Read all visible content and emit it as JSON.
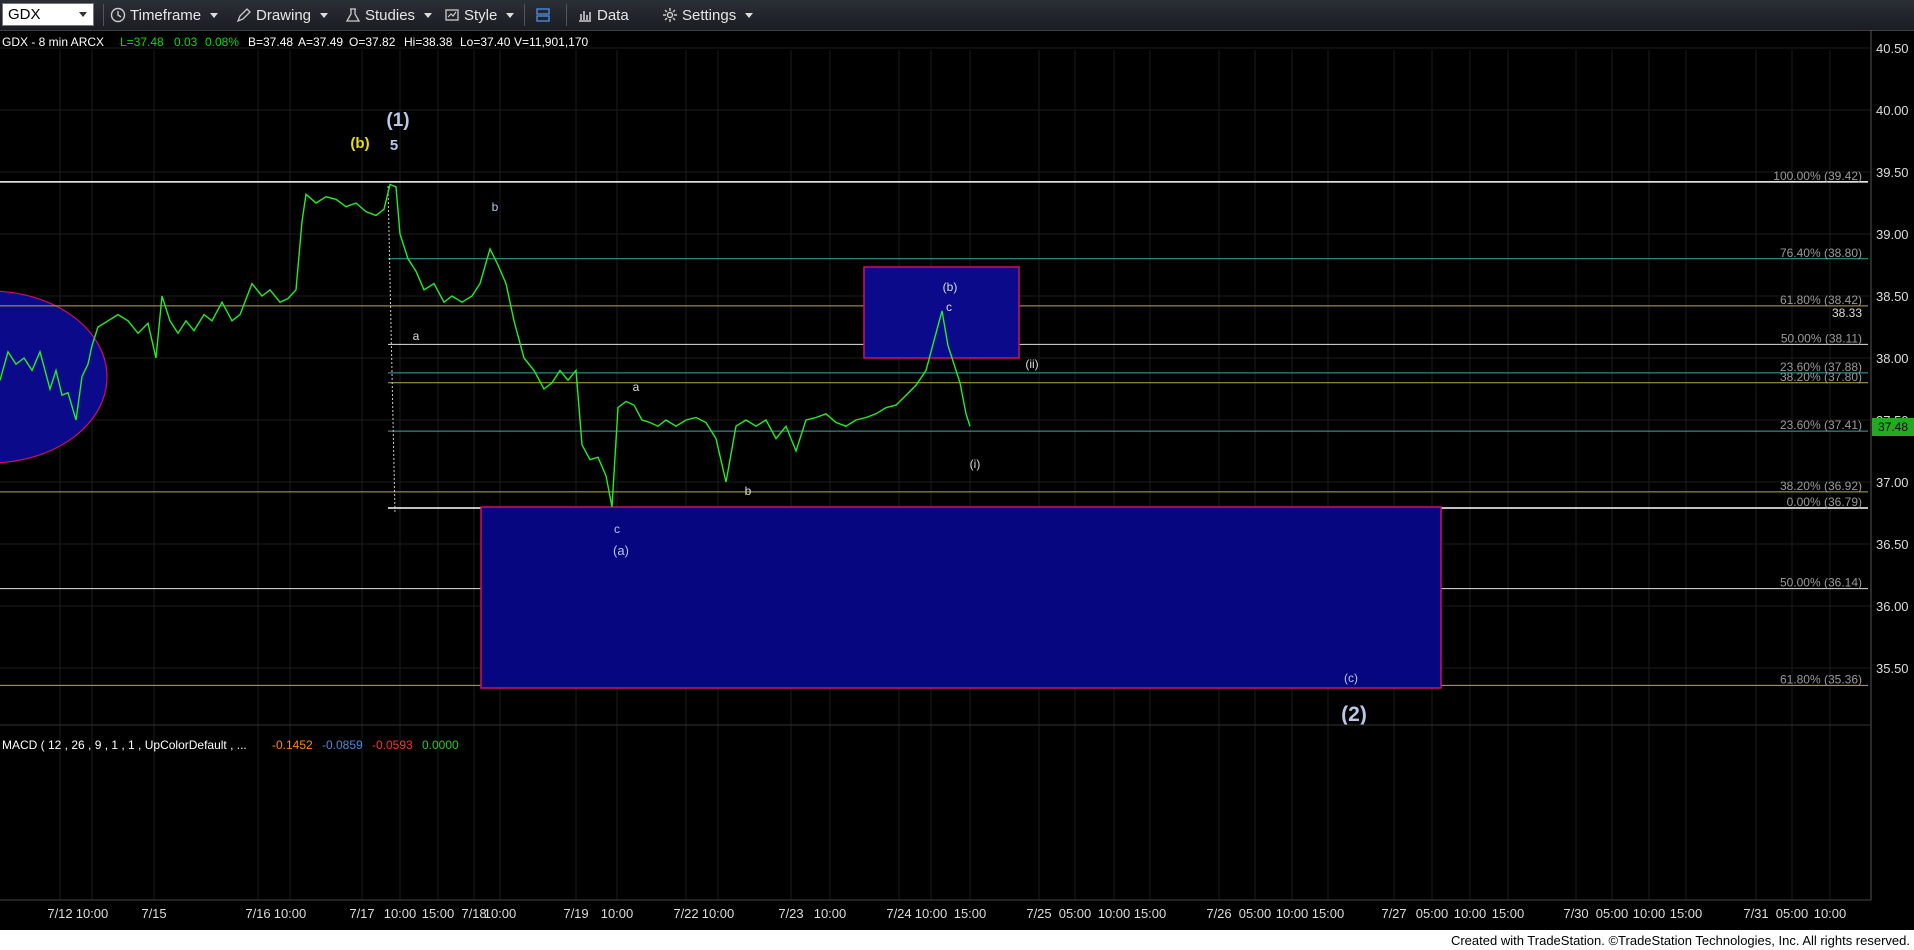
{
  "toolbar": {
    "symbol": "GDX",
    "items": [
      {
        "label": "Timeframe",
        "icon": "clock-icon"
      },
      {
        "label": "Drawing",
        "icon": "pencil-icon"
      },
      {
        "label": "Studies",
        "icon": "studies-icon"
      },
      {
        "label": "Style",
        "icon": "style-icon"
      },
      {
        "label": "",
        "icon": "layout-icon"
      },
      {
        "label": "Data",
        "icon": "bar-chart-icon"
      },
      {
        "label": "Settings",
        "icon": "gear-icon"
      }
    ]
  },
  "header": {
    "symbol_info": "GDX - 8 min  ARCX",
    "last": "L=37.48",
    "change": "0.03",
    "change_pct": "0.08%",
    "bid": "B=37.48",
    "ask": "A=37.49",
    "open": "O=37.82",
    "high": "Hi=38.38",
    "low": "Lo=37.40",
    "volume": "V=11,901,170"
  },
  "macd": {
    "label": "MACD ( 12 , 26 , 9 , 1 , 1 , UpColorDefault , ...",
    "v1": "-0.1452",
    "v2": "-0.0859",
    "v3": "-0.0593",
    "v4": "0.0000"
  },
  "footer_text": "Created with TradeStation. ©TradeStation Technologies, Inc. All rights reserved.",
  "chart_data": {
    "type": "line",
    "title": "GDX - 8 min",
    "y_ticks": [
      "40.50",
      "40.00",
      "39.50",
      "39.00",
      "38.50",
      "38.00",
      "37.50",
      "37.00",
      "36.50",
      "36.00",
      "35.50"
    ],
    "ylim": [
      35.1,
      40.6
    ],
    "last_price_label": "37.48",
    "level_label": "38.33",
    "x_ticks": [
      "7/12",
      "10:00",
      "7/15",
      "7/16",
      "10:00",
      "7/17",
      "10:00",
      "15:00",
      "7/18",
      "10:00",
      "7/19",
      "10:00",
      "7/22",
      "10:00",
      "7/23",
      "10:00",
      "7/24",
      "10:00",
      "15:00",
      "7/25",
      "05:00",
      "10:00",
      "15:00",
      "7/26",
      "05:00",
      "10:00",
      "15:00",
      "7/27",
      "05:00",
      "10:00",
      "15:00",
      "7/30",
      "05:00",
      "10:00",
      "15:00",
      "7/31",
      "05:00",
      "10:00"
    ],
    "fib_levels": [
      {
        "label": "100.00% (39.42)",
        "value": 39.42,
        "color": "#ffffff"
      },
      {
        "label": "76.40% (38.80)",
        "value": 38.8,
        "color": "#3aa8a8"
      },
      {
        "label": "61.80% (38.42)",
        "value": 38.42,
        "color": "#b8a84a"
      },
      {
        "label": "50.00% (38.11)",
        "value": 38.11,
        "color": "#e0e0e0"
      },
      {
        "label": "23.60% (37.88)",
        "value": 37.88,
        "color": "#3aa8a8"
      },
      {
        "label": "38.20% (37.80)",
        "value": 37.8,
        "color": "#b8a84a"
      },
      {
        "label": "23.60% (37.41)",
        "value": 37.41,
        "color": "#3aa8a8"
      },
      {
        "label": "38.20% (36.92)",
        "value": 36.92,
        "color": "#b8a84a"
      },
      {
        "label": "0.00% (36.79)",
        "value": 36.79,
        "color": "#ffffff"
      },
      {
        "label": "50.00% (36.14)",
        "value": 36.14,
        "color": "#e0e0e0"
      },
      {
        "label": "61.80% (35.36)",
        "value": 35.36,
        "color": "#b8a84a"
      }
    ],
    "wave_labels": [
      {
        "text": "(1)",
        "color": "#b8c8e8"
      },
      {
        "text": "5",
        "color": "#b8c8e8"
      },
      {
        "text": "(b)",
        "color": "#e8e000"
      },
      {
        "text": "b",
        "color": "#b8c8e8"
      },
      {
        "text": "a",
        "color": "#dddddd"
      },
      {
        "text": "a",
        "color": "#dddddd"
      },
      {
        "text": "c",
        "color": "#b8c8e8"
      },
      {
        "text": "(a)",
        "color": "#b8c8e8"
      },
      {
        "text": "b",
        "color": "#dddddd"
      },
      {
        "text": "(b)",
        "color": "#dddddd"
      },
      {
        "text": "c",
        "color": "#dddddd"
      },
      {
        "text": "(ii)",
        "color": "#dddddd"
      },
      {
        "text": "(i)",
        "color": "#dddddd"
      },
      {
        "text": "(c)",
        "color": "#b8c8e8"
      },
      {
        "text": "(2)",
        "color": "#b8c8e8"
      }
    ],
    "price_series": [
      [
        0,
        37.82
      ],
      [
        8,
        38.05
      ],
      [
        16,
        37.95
      ],
      [
        24,
        38.0
      ],
      [
        32,
        37.9
      ],
      [
        40,
        38.05
      ],
      [
        50,
        37.75
      ],
      [
        56,
        37.9
      ],
      [
        62,
        37.7
      ],
      [
        68,
        37.72
      ],
      [
        76,
        37.5
      ],
      [
        82,
        37.85
      ],
      [
        88,
        37.95
      ],
      [
        92,
        38.1
      ],
      [
        98,
        38.25
      ],
      [
        108,
        38.3
      ],
      [
        118,
        38.35
      ],
      [
        128,
        38.3
      ],
      [
        138,
        38.2
      ],
      [
        148,
        38.28
      ],
      [
        156,
        38.0
      ],
      [
        162,
        38.5
      ],
      [
        170,
        38.3
      ],
      [
        178,
        38.2
      ],
      [
        186,
        38.3
      ],
      [
        194,
        38.22
      ],
      [
        204,
        38.35
      ],
      [
        212,
        38.3
      ],
      [
        222,
        38.45
      ],
      [
        232,
        38.3
      ],
      [
        240,
        38.35
      ],
      [
        252,
        38.6
      ],
      [
        262,
        38.5
      ],
      [
        270,
        38.55
      ],
      [
        280,
        38.45
      ],
      [
        288,
        38.48
      ],
      [
        296,
        38.55
      ],
      [
        302,
        39.1
      ],
      [
        306,
        39.32
      ],
      [
        316,
        39.25
      ],
      [
        326,
        39.3
      ],
      [
        336,
        39.28
      ],
      [
        346,
        39.22
      ],
      [
        356,
        39.25
      ],
      [
        366,
        39.18
      ],
      [
        376,
        39.15
      ],
      [
        384,
        39.2
      ],
      [
        390,
        39.4
      ],
      [
        396,
        39.38
      ],
      [
        400,
        39.0
      ],
      [
        408,
        38.8
      ],
      [
        416,
        38.7
      ],
      [
        424,
        38.55
      ],
      [
        434,
        38.6
      ],
      [
        444,
        38.45
      ],
      [
        452,
        38.5
      ],
      [
        462,
        38.45
      ],
      [
        472,
        38.5
      ],
      [
        480,
        38.6
      ],
      [
        490,
        38.88
      ],
      [
        498,
        38.75
      ],
      [
        506,
        38.6
      ],
      [
        514,
        38.3
      ],
      [
        524,
        38.0
      ],
      [
        534,
        37.9
      ],
      [
        544,
        37.75
      ],
      [
        552,
        37.8
      ],
      [
        560,
        37.9
      ],
      [
        568,
        37.82
      ],
      [
        576,
        37.9
      ],
      [
        582,
        37.3
      ],
      [
        590,
        37.18
      ],
      [
        598,
        37.2
      ],
      [
        606,
        37.05
      ],
      [
        612,
        36.8
      ],
      [
        618,
        37.6
      ],
      [
        626,
        37.65
      ],
      [
        634,
        37.62
      ],
      [
        642,
        37.5
      ],
      [
        650,
        37.48
      ],
      [
        658,
        37.45
      ],
      [
        666,
        37.5
      ],
      [
        676,
        37.45
      ],
      [
        686,
        37.5
      ],
      [
        696,
        37.52
      ],
      [
        706,
        37.48
      ],
      [
        716,
        37.35
      ],
      [
        726,
        37.0
      ],
      [
        736,
        37.45
      ],
      [
        746,
        37.5
      ],
      [
        756,
        37.45
      ],
      [
        766,
        37.5
      ],
      [
        776,
        37.35
      ],
      [
        786,
        37.45
      ],
      [
        796,
        37.25
      ],
      [
        806,
        37.5
      ],
      [
        816,
        37.52
      ],
      [
        826,
        37.55
      ],
      [
        836,
        37.48
      ],
      [
        846,
        37.45
      ],
      [
        856,
        37.5
      ],
      [
        866,
        37.52
      ],
      [
        876,
        37.55
      ],
      [
        886,
        37.6
      ],
      [
        896,
        37.62
      ],
      [
        906,
        37.7
      ],
      [
        916,
        37.78
      ],
      [
        926,
        37.9
      ],
      [
        936,
        38.2
      ],
      [
        942,
        38.38
      ],
      [
        948,
        38.1
      ],
      [
        954,
        37.95
      ],
      [
        960,
        37.8
      ],
      [
        966,
        37.55
      ],
      [
        970,
        37.45
      ]
    ]
  }
}
